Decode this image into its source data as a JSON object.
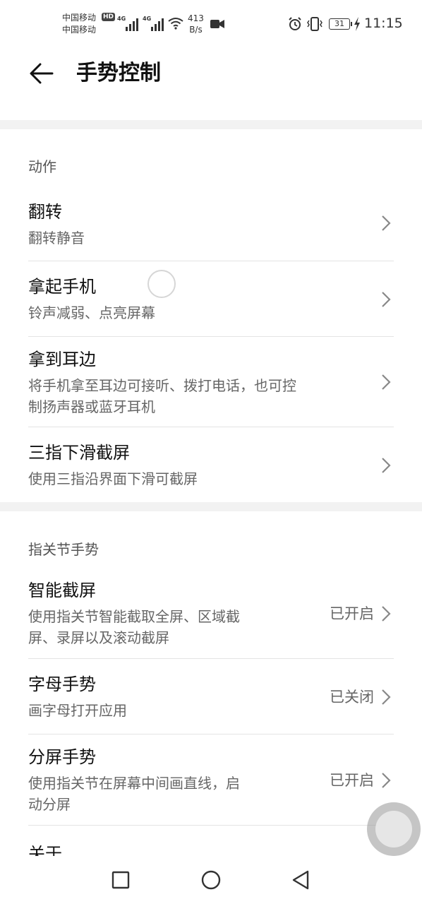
{
  "status_bar": {
    "carrier1": "中国移动",
    "carrier2": "中国移动",
    "hd": "HD",
    "lte1": "4G",
    "lte2": "4G",
    "net_speed_value": "413",
    "net_speed_unit": "B/s",
    "battery": "31",
    "time": "11:15"
  },
  "header": {
    "title": "手势控制"
  },
  "sections": {
    "actions": {
      "label": "动作",
      "items": [
        {
          "title": "翻转",
          "subtitle": "翻转静音"
        },
        {
          "title": "拿起手机",
          "subtitle": "铃声减弱、点亮屏幕"
        },
        {
          "title": "拿到耳边",
          "subtitle_line1": "将手机拿至耳边可接听、拨打电话，也可控",
          "subtitle_line2": "制扬声器或蓝牙耳机"
        },
        {
          "title": "三指下滑截屏",
          "subtitle": "使用三指沿界面下滑可截屏"
        }
      ]
    },
    "knuckle": {
      "label": "指关节手势",
      "items": [
        {
          "title": "智能截屏",
          "subtitle_line1": "使用指关节智能截取全屏、区域截",
          "subtitle_line2": "屏、录屏以及滚动截屏",
          "status": "已开启"
        },
        {
          "title": "字母手势",
          "subtitle": "画字母打开应用",
          "status": "已关闭"
        },
        {
          "title": "分屏手势",
          "subtitle_line1": "使用指关节在屏幕中间画直线，启",
          "subtitle_line2": "动分屏",
          "status": "已开启"
        },
        {
          "title": "关于"
        }
      ]
    }
  },
  "icons": {
    "back": "arrow-left-icon",
    "chevron": "chevron-right-icon",
    "nav_recent": "square-icon",
    "nav_home": "circle-icon",
    "nav_back": "triangle-back-icon"
  },
  "colors": {
    "section_gap": "#f2f2f2",
    "divider": "#e4e4e4"
  }
}
